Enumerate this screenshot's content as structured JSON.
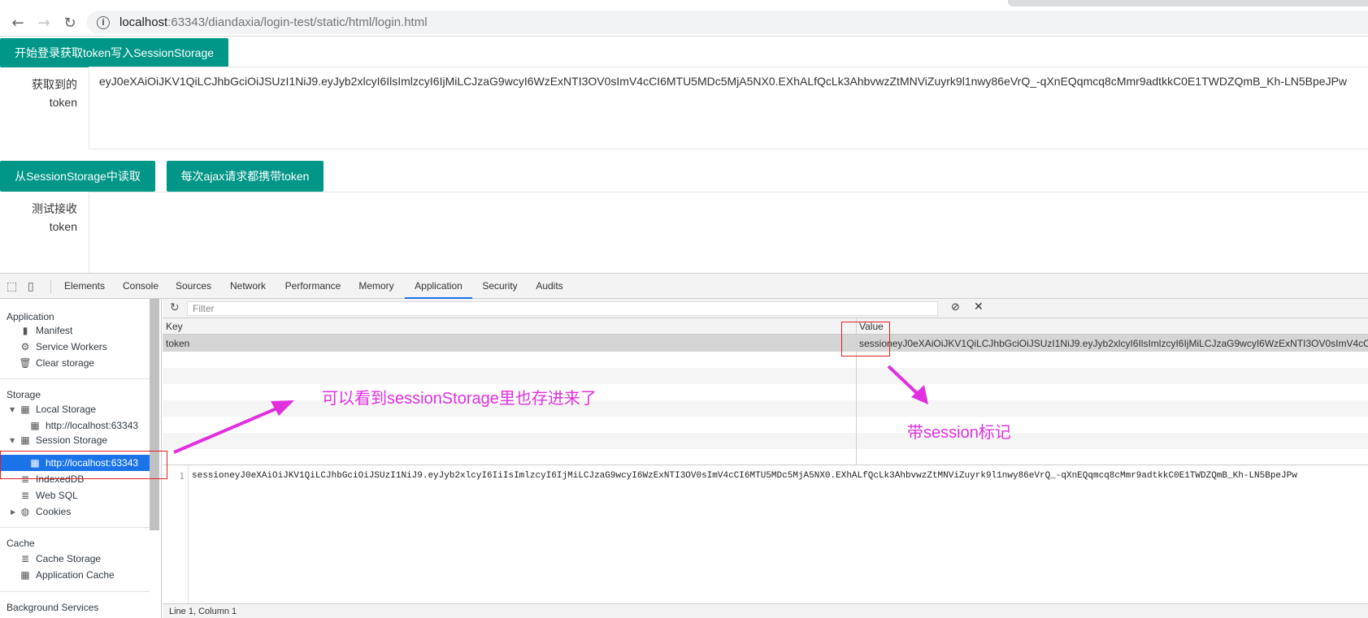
{
  "browser": {
    "url_host": "localhost",
    "url_path": ":63343/diandaxia/login-test/static/html/login.html"
  },
  "page": {
    "login_button": "开始登录获取token写入SessionStorage",
    "label_got_token_1": "获取到的",
    "label_got_token_2": "token",
    "token_value": "eyJ0eXAiOiJKV1QiLCJhbGciOiJSUzI1NiJ9.eyJyb2xlcyI6IlsImlzcyI6IjMiLCJzaG9wcyI6WzExNTI3OV0sImV4cCI6MTU5MDc5MjA5NX0.EXhALfQcLk3AhbvwzZtMNViZuyrk9l1nwy86eVrQ_-qXnEQqmcq8cMmr9adtkkC0E1TWDZQmB_Kh-LN5BpeJPw",
    "read_button": "从SessionStorage中读取",
    "ajax_button": "每次ajax请求都携带token",
    "label_test_1": "测试接收",
    "label_test_2": "token"
  },
  "devtools": {
    "tabs": [
      "Elements",
      "Console",
      "Sources",
      "Network",
      "Performance",
      "Memory",
      "Application",
      "Security",
      "Audits"
    ],
    "active_tab": "Application",
    "sidebar": {
      "section_application": "Application",
      "manifest": "Manifest",
      "service_workers": "Service Workers",
      "clear_storage": "Clear storage",
      "section_storage": "Storage",
      "local_storage": "Local Storage",
      "local_storage_origin": "http://localhost:63343",
      "session_storage": "Session Storage",
      "session_storage_origin": "http://localhost:63343",
      "indexeddb": "IndexedDB",
      "web_sql": "Web SQL",
      "cookies": "Cookies",
      "section_cache": "Cache",
      "cache_storage": "Cache Storage",
      "application_cache": "Application Cache",
      "section_background": "Background Services"
    },
    "filter_placeholder": "Filter",
    "grid": {
      "col_key": "Key",
      "col_value": "Value",
      "row_key": "token",
      "row_value": "sessioneyJ0eXAiOiJKV1QiLCJhbGciOiJSUzI1NiJ9.eyJyb2xlcyI6IlsImlzcyI6IjMiLCJzaG9wcyI6WzExNTI3OV0sImV4cCI6MTU"
    },
    "preview": {
      "line_number": "1",
      "line_text": "sessioneyJ0eXAiOiJKV1QiLCJhbGciOiJSUzI1NiJ9.eyJyb2xlcyI6IiIsImlzcyI6IjMiLCJzaG9wcyI6WzExNTI3OV0sImV4cCI6MTU5MDc5MjA5NX0.EXhALfQcLk3AhbvwzZtMNViZuyrk9l1nwy86eVrQ_-qXnEQqmcq8cMmr9adtkkC0E1TWDZQmB_Kh-LN5BpeJPw",
      "status": "Line 1, Column 1"
    }
  },
  "annotations": {
    "storage_note": "可以看到sessionStorage里也存进来了",
    "session_mark_note": "带session标记",
    "color": "#e030e0"
  }
}
